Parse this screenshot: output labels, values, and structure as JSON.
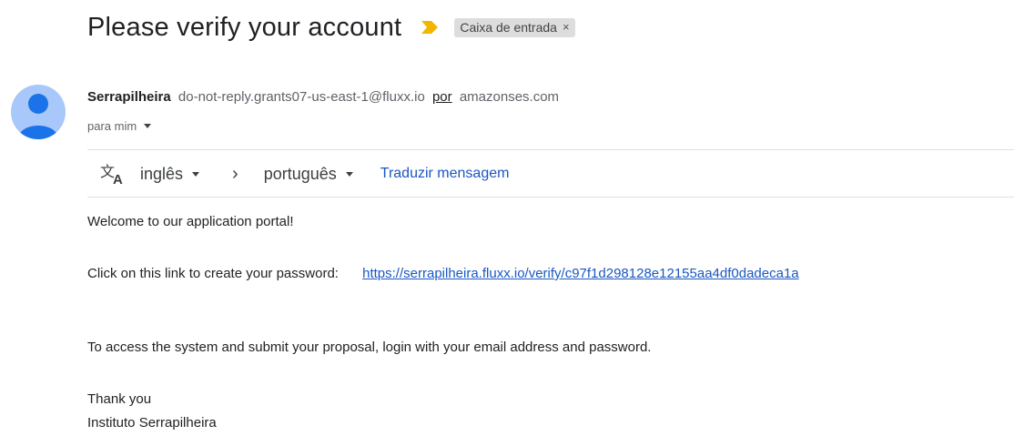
{
  "email": {
    "subject": "Please verify your account",
    "label": "Caixa de entrada",
    "label_remove": "×",
    "sender": {
      "name": "Serrapilheira",
      "email": "do-not-reply.grants07-us-east-1@fluxx.io",
      "via_label": "por",
      "via_domain": "amazonses.com"
    },
    "recipient_text": "para mim"
  },
  "translate": {
    "from_lang": "inglês",
    "arrow": "›",
    "to_lang": "português",
    "action": "Traduzir mensagem"
  },
  "body": {
    "greeting": "Welcome to our application portal!",
    "link_prompt": "Click on this link to create your password:",
    "link": "https://serrapilheira.fluxx.io/verify/c97f1d298128e12155aa4df0dadeca1a",
    "instructions": "To access the system and submit your proposal, login with your email address and password.",
    "closing": "Thank you",
    "signature": "Instituto Serrapilheira"
  },
  "colors": {
    "importance_marker": "#f2b500",
    "avatar_bg": "#a8c7fa",
    "avatar_person": "#1a73e8",
    "link": "#1a57c4"
  },
  "icons": {
    "importance": "importance-marker-icon",
    "avatar": "person-icon",
    "translate": "translate-icon",
    "caret": "chevron-down-icon"
  }
}
